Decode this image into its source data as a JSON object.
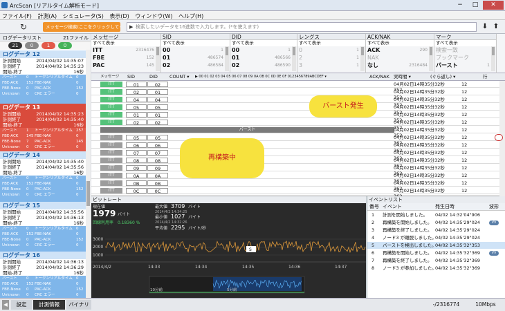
{
  "window": {
    "title": "ArcScan [リアルタイム解析モード]",
    "min": "−",
    "max": "□",
    "close": "✕"
  },
  "menu": [
    "ファイル(F)",
    "計測(A)",
    "シミュレータ(S)",
    "表示(D)",
    "ウィンドウ(W)",
    "ヘルプ(H)"
  ],
  "toolbar": {
    "refresh": "↻",
    "msg_search": "メッセージ検索(ここをクリックしてください)",
    "search_prefix": "▶",
    "search_placeholder": "検索したいデータを16進数で入力します。(*を使えます)",
    "down": "⬇",
    "up": "⬆"
  },
  "left": {
    "title": "ログデータリスト",
    "count": "21ファイル",
    "pills": [
      "21",
      "0",
      "1",
      "0"
    ],
    "groups": [
      {
        "title": "ログデータ 12",
        "start_l": "計測開始",
        "start": "2014/04/02 14:35:07",
        "end_l": "計測終了",
        "end": "2014/04/02 14:35:23",
        "dur_l": "開始-終了",
        "dur": "16秒",
        "grid": [
          "バースト",
          "0",
          "トークンリアルタイム",
          "0",
          "FBE-ACK",
          "152",
          "FBE-NAK",
          "0",
          "FBE-None",
          "0",
          "PAC-ACK",
          "152",
          "Unknown",
          "0",
          "CRC エラー",
          "0"
        ]
      },
      {
        "title": "ログデータ 13",
        "start_l": "計測開始",
        "start": "2014/04/02 14:35:23",
        "end_l": "計測終了",
        "end": "2014/04/02 14:35:40",
        "dur_l": "開始-終了",
        "dur": "16秒",
        "grid": [
          "バースト",
          "1",
          "トークンリアルタイム",
          "257",
          "FBE-ACK",
          "145",
          "FBE-NAK",
          "0",
          "FBE-None",
          "7",
          "PAC-ACK",
          "145",
          "Unknown",
          "0",
          "CRC エラー",
          "0"
        ]
      },
      {
        "title": "ログデータ 14",
        "start_l": "計測開始",
        "start": "2014/04/02 14:35:40",
        "end_l": "計測終了",
        "end": "2014/04/02 14:35:56",
        "dur_l": "開始-終了",
        "dur": "16秒",
        "grid": [
          "バースト",
          "0",
          "トークンリアルタイム",
          "0",
          "FBE-ACK",
          "152",
          "FBE-NAK",
          "0",
          "FBE-None",
          "0",
          "PAC-ACK",
          "152",
          "Unknown",
          "0",
          "CRC エラー",
          "0"
        ]
      },
      {
        "title": "ログデータ 15",
        "start_l": "計測開始",
        "start": "2014/04/02 14:35:56",
        "end_l": "計測終了",
        "end": "2014/04/02 14:36:13",
        "dur_l": "開始-終了",
        "dur": "16秒",
        "grid": [
          "バースト",
          "0",
          "トークンリアルタイム",
          "0",
          "FBE-ACK",
          "152",
          "FBE-NAK",
          "0",
          "FBE-None",
          "0",
          "PAC-ACK",
          "152",
          "Unknown",
          "0",
          "CRC エラー",
          "0"
        ]
      },
      {
        "title": "ログデータ 16",
        "start_l": "計測開始",
        "start": "2014/04/02 14:36:13",
        "end_l": "計測終了",
        "end": "2014/04/02 14:36:29",
        "dur_l": "開始-終了",
        "dur": "16秒",
        "grid": [
          "バースト",
          "0",
          "トークンリアルタイム",
          "0",
          "FBE-ACK",
          "152",
          "FBE-NAK",
          "0",
          "FBE-None",
          "0",
          "PAC-ACK",
          "152",
          "Unknown",
          "0",
          "CRC エラー",
          "0"
        ]
      }
    ]
  },
  "filters": [
    {
      "h": "メッセージ",
      "sel": "すべて表示",
      "rows": [
        [
          "ITT",
          "2316476"
        ],
        [
          "FBE",
          "152"
        ],
        [
          "PAC",
          "145"
        ]
      ]
    },
    {
      "h": "SID",
      "sel": "すべて表示",
      "rows": [
        [
          "00",
          "1"
        ],
        [
          "01",
          "486574"
        ],
        [
          "02",
          "486584"
        ]
      ]
    },
    {
      "h": "DID",
      "sel": "すべて表示",
      "rows": [
        [
          "00",
          "1"
        ],
        [
          "01",
          "486566"
        ],
        [
          "02",
          "486590"
        ]
      ]
    },
    {
      "h": "レングス",
      "sel": "すべて表示",
      "rows": [
        [
          "0",
          "1"
        ],
        [
          "2",
          "1"
        ],
        [
          "3",
          "1"
        ]
      ]
    },
    {
      "h": "ACK/NAK",
      "sel": "すべて表示",
      "rows": [
        [
          "ACK",
          "290"
        ],
        [
          "NAK",
          ""
        ],
        [
          "なし",
          "2316484"
        ]
      ]
    },
    {
      "h": "マーク",
      "sel": "すべて表示",
      "rows": [
        [
          "検索一致",
          ""
        ],
        [
          "ブックマーク",
          ""
        ],
        [
          "バースト",
          "1"
        ]
      ]
    }
  ],
  "grid": {
    "headers": [
      "メッセージ",
      "SID",
      "DID",
      "COUNT ▾",
      "▶ 00 01 02 03 04 05 06 07 08 09 0A 0B 0C 0D 0E 0F  0123456789ABCDEF ▾",
      "ACK/NAK",
      "実時間 ▾",
      "(ぐら返し) ▾",
      "行"
    ],
    "rows": [
      {
        "m": "ITT",
        "s": "01",
        "d": "02",
        "t": "04月02日14時35分32秒352",
        "g": false
      },
      {
        "m": "ITT",
        "s": "02",
        "d": "01",
        "t": "04月02日14時35分32秒352",
        "g": false
      },
      {
        "m": "ITT",
        "s": "04",
        "d": "04",
        "t": "04月02日14時35分32秒352",
        "g": false
      },
      {
        "m": "ITT",
        "s": "05",
        "d": "05",
        "t": "04月02日14時35分32秒352",
        "g": false
      },
      {
        "m": "ITT",
        "s": "01",
        "d": "01",
        "t": "04月02日14時35分32秒352",
        "g": false
      },
      {
        "m": "ITT",
        "s": "02",
        "d": "02",
        "t": "04月02日14時35分32秒352",
        "g": false
      },
      {
        "burst": "バースト",
        "t": "04月02日14時35分32秒352"
      },
      {
        "m": "ITT",
        "s": "05",
        "d": "05",
        "t": "04月02日14時35分32秒362",
        "g": true
      },
      {
        "m": "ITT",
        "s": "06",
        "d": "06",
        "t": "04月02日14時35分32秒362",
        "g": true
      },
      {
        "m": "ITT",
        "s": "07",
        "d": "07",
        "t": "04月02日14時35分32秒362",
        "g": true
      },
      {
        "m": "ITT",
        "s": "08",
        "d": "08",
        "t": "04月02日14時35分32秒362",
        "g": true
      },
      {
        "m": "ITT",
        "s": "09",
        "d": "09",
        "t": "04月02日14時35分32秒362",
        "g": true
      },
      {
        "m": "ITT",
        "s": "0A",
        "d": "0A",
        "t": "04月02日14時35分32秒362",
        "g": true
      },
      {
        "m": "ITT",
        "s": "0B",
        "d": "0B",
        "t": "04月02日14時35分32秒362",
        "g": true
      },
      {
        "m": "ITT",
        "s": "0C",
        "d": "0C",
        "t": "04月02日14時35分32秒362",
        "g": true
      }
    ],
    "row_no": "12",
    "callout_burst": "バースト発生",
    "callout_rebuild": "再構築中"
  },
  "bitrate": {
    "title": "ビットレート",
    "current_l": "現在値",
    "current": "1979",
    "unit": "バイト",
    "recv_l": "回線利用率",
    "recv": "0.18360 %",
    "max_l": "最大値",
    "max": "3709",
    "max_t": "2014/4/2 14:34:25",
    "min_l": "最小値",
    "min": "1027",
    "min_t": "2014/4/2 14:32:26",
    "avg_l": "平均値",
    "avg": "2295",
    "avg_u": "バイト/秒",
    "y": [
      "3000",
      "2000",
      "1000"
    ],
    "x": [
      "2014/4/2",
      "14:33",
      "14:34",
      "14:35",
      "14:36",
      "14:37"
    ],
    "marker": "S",
    "ov_l": "10分前",
    "ov_r": "5分前"
  },
  "events": {
    "title": "イベントリスト",
    "h_no": "番号",
    "h_ev": "イベント",
    "h_time": "発生日時",
    "h_wave": "波形",
    "rows": [
      {
        "n": "1",
        "e": "計測を開始しました。",
        "t": "04/02 14:32'04\"906",
        "w": ""
      },
      {
        "n": "2",
        "e": "再構築を開始しました。",
        "t": "04/02 14:35'29\"024",
        "w": "VV"
      },
      {
        "n": "3",
        "e": "再構築を終了しました。",
        "t": "04/02 14:35'29\"024",
        "w": ""
      },
      {
        "n": "4",
        "e": "ノード3 が離脱しました。",
        "t": "04/02 14:35'29\"024",
        "w": ""
      },
      {
        "n": "5",
        "e": "バーストを検出しました。",
        "t": "04/02 14:35'32\"353",
        "w": ""
      },
      {
        "n": "6",
        "e": "再構築を開始しました。",
        "t": "04/02 14:35'32\"369",
        "w": "VV"
      },
      {
        "n": "7",
        "e": "再構築を終了しました。",
        "t": "04/02 14:35'32\"369",
        "w": ""
      },
      {
        "n": "8",
        "e": "ノード3 が参加しました。",
        "t": "04/02 14:35'32\"369",
        "w": ""
      }
    ]
  },
  "status": {
    "tabs": [
      "設定",
      "計測情報",
      "バイナリ"
    ],
    "pos": "-/2316774",
    "speed": "10Mbps"
  },
  "chart_data": {
    "type": "line",
    "title": "ビットレート",
    "ylim": [
      0,
      3709
    ],
    "y_ticks": [
      "3000",
      "2000",
      "1000"
    ],
    "x_ticks": [
      "2014/4/2",
      "14:33",
      "14:34",
      "14:35",
      "14:36",
      "14:37"
    ],
    "series": [
      {
        "values": []
      }
    ]
  }
}
